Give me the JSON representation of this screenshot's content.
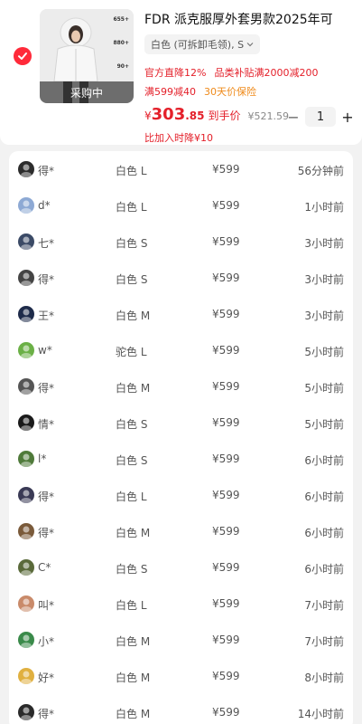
{
  "product": {
    "title": "FDR 派克服厚外套男款2025年可",
    "variant": "白色 (可拆卸毛领), S",
    "thumb_tag": "采购中",
    "thumb_specs": [
      "655+",
      "880+",
      "90+"
    ],
    "selected": true,
    "promos_line1": [
      "官方直降12%",
      "品类补贴满2000减200"
    ],
    "promos_line2": [
      "满599减40",
      "30天价保险"
    ],
    "price_symbol": "¥",
    "price_int": "303",
    "price_dec": ".85",
    "price_label": "到手价",
    "original_price": "¥521.59",
    "quantity": "1",
    "minus": "−",
    "plus": "+",
    "cart_note": "比加入时降¥10"
  },
  "purchases": [
    {
      "user": "得*",
      "variant": "白色 L",
      "price": "¥599",
      "time": "56分钟前",
      "avatar": "#2c2c2c"
    },
    {
      "user": "d*",
      "variant": "白色 L",
      "price": "¥599",
      "time": "1小时前",
      "avatar": "#8da9d4"
    },
    {
      "user": "七*",
      "variant": "白色 S",
      "price": "¥599",
      "time": "3小时前",
      "avatar": "#3b4a66"
    },
    {
      "user": "得*",
      "variant": "白色 S",
      "price": "¥599",
      "time": "3小时前",
      "avatar": "#444444"
    },
    {
      "user": "王*",
      "variant": "白色 M",
      "price": "¥599",
      "time": "3小时前",
      "avatar": "#1e2b4a"
    },
    {
      "user": "w*",
      "variant": "驼色 L",
      "price": "¥599",
      "time": "5小时前",
      "avatar": "#6bb046"
    },
    {
      "user": "得*",
      "variant": "白色 M",
      "price": "¥599",
      "time": "5小时前",
      "avatar": "#555555"
    },
    {
      "user": "情*",
      "variant": "白色 S",
      "price": "¥599",
      "time": "5小时前",
      "avatar": "#1a1a1a"
    },
    {
      "user": "l*",
      "variant": "白色 S",
      "price": "¥599",
      "time": "6小时前",
      "avatar": "#4f7a3a"
    },
    {
      "user": "得*",
      "variant": "白色 L",
      "price": "¥599",
      "time": "6小时前",
      "avatar": "#3a3a55"
    },
    {
      "user": "得*",
      "variant": "白色 M",
      "price": "¥599",
      "time": "6小时前",
      "avatar": "#7a5a3a"
    },
    {
      "user": "C*",
      "variant": "白色 S",
      "price": "¥599",
      "time": "6小时前",
      "avatar": "#5a6a3a"
    },
    {
      "user": "叫*",
      "variant": "白色 L",
      "price": "¥599",
      "time": "7小时前",
      "avatar": "#c98a6a"
    },
    {
      "user": "小*",
      "variant": "白色 M",
      "price": "¥599",
      "time": "7小时前",
      "avatar": "#3a8a4a"
    },
    {
      "user": "好*",
      "variant": "白色 M",
      "price": "¥599",
      "time": "8小时前",
      "avatar": "#e0b040"
    },
    {
      "user": "得*",
      "variant": "白色 M",
      "price": "¥599",
      "time": "14小时前",
      "avatar": "#2a2a2a"
    }
  ],
  "colors": {
    "accent": "#e4202a",
    "orange": "#ef8a1a",
    "check": "#ff2a3a"
  }
}
